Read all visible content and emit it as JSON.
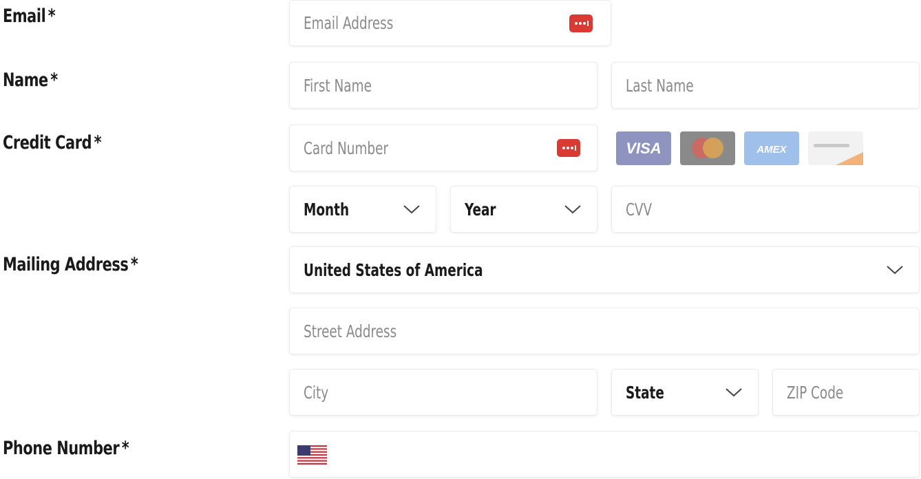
{
  "form": {
    "email": {
      "label": "Email",
      "required_mark": "*",
      "placeholder": "Email Address",
      "autofill_icon": "password-manager-icon"
    },
    "name": {
      "label": "Name",
      "required_mark": "*",
      "first_placeholder": "First Name",
      "last_placeholder": "Last Name"
    },
    "credit_card": {
      "label": "Credit Card",
      "required_mark": "*",
      "number_placeholder": "Card Number",
      "autofill_icon": "password-manager-icon",
      "card_logos": [
        {
          "name": "visa",
          "text": "VISA",
          "color": "#8f93bf"
        },
        {
          "name": "mastercard",
          "color": "#8a8a8a"
        },
        {
          "name": "amex",
          "text": "AMEX",
          "color": "#9ec0ea"
        },
        {
          "name": "discover",
          "color": "#f2f2f2"
        }
      ],
      "month_value": "Month",
      "year_value": "Year",
      "cvv_placeholder": "CVV"
    },
    "mailing_address": {
      "label": "Mailing Address",
      "required_mark": "*",
      "country_value": "United States of America",
      "street_placeholder": "Street Address",
      "city_placeholder": "City",
      "state_value": "State",
      "zip_placeholder": "ZIP Code"
    },
    "phone": {
      "label": "Phone Number",
      "required_mark": "*",
      "country_flag": "us-flag-icon"
    }
  },
  "colors": {
    "autofill_icon": "#d93b34",
    "field_border": "#ececec",
    "placeholder": "#8a8a8a",
    "label": "#1a1a1a"
  }
}
